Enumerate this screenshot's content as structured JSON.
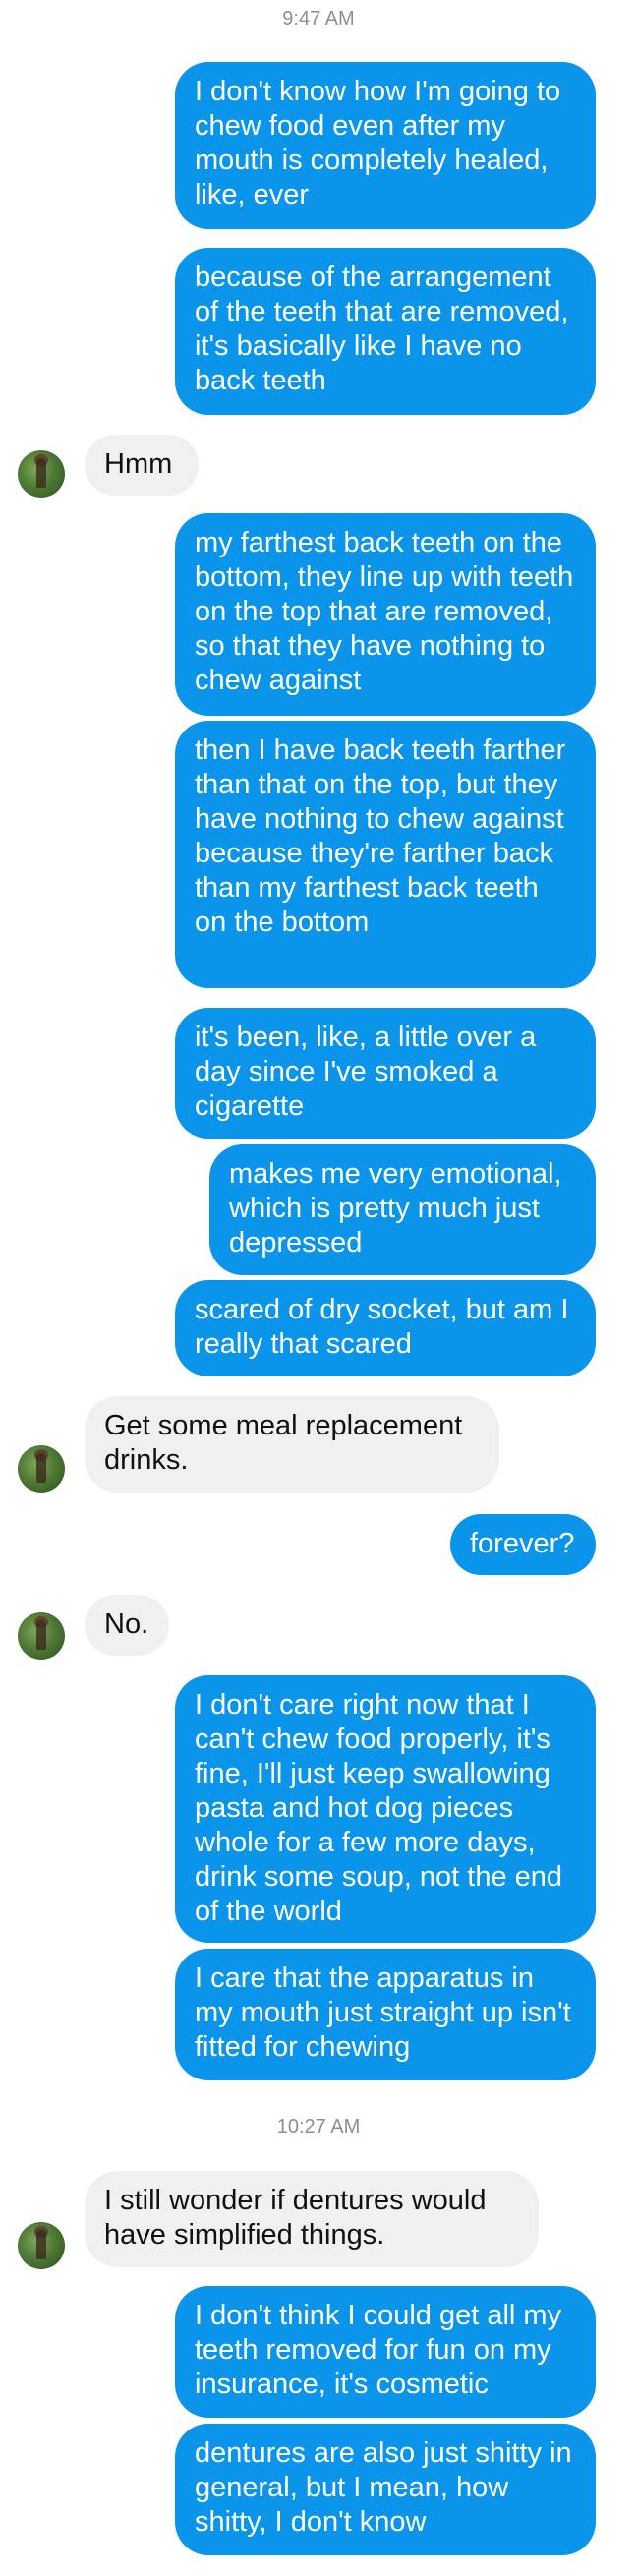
{
  "timestamps": [
    "9:47 AM",
    "10:27 AM"
  ],
  "messages": [
    {
      "dir": "out",
      "text": "I don't know how I'm going to chew food even after my mouth is completely healed, like, ever"
    },
    {
      "dir": "out",
      "text": "because of the arrangement of the teeth that are removed, it's basically like I have no back teeth"
    },
    {
      "dir": "in",
      "text": "Hmm"
    },
    {
      "dir": "out",
      "text": "my farthest back teeth on the bottom, they line up with teeth on the top that are removed, so that they have nothing to chew against"
    },
    {
      "dir": "out",
      "text": "then I have back teeth farther than that on the top, but they have nothing to chew against because they're farther back than my farthest back teeth on the bottom"
    },
    {
      "dir": "out",
      "text": "it's been, like, a little over a day since I've smoked a cigarette"
    },
    {
      "dir": "out",
      "text": "makes me very emotional, which is pretty much just depressed"
    },
    {
      "dir": "out",
      "text": "scared of dry socket, but am I really that scared"
    },
    {
      "dir": "in",
      "text": "Get some meal replacement drinks."
    },
    {
      "dir": "out",
      "text": "forever?"
    },
    {
      "dir": "in",
      "text": "No."
    },
    {
      "dir": "out",
      "text": "I don't care right now that I can't chew food properly, it's fine, I'll just keep swallowing pasta and hot dog pieces whole for a few more days, drink some soup, not the end of the world"
    },
    {
      "dir": "out",
      "text": "I care that the apparatus in my mouth just straight up isn't fitted for chewing"
    },
    {
      "dir": "in",
      "text": "I still wonder if dentures would have simplified things."
    },
    {
      "dir": "out",
      "text": "I don't think I could get all my teeth removed for fun on my insurance, it's cosmetic"
    },
    {
      "dir": "out",
      "text": "dentures are also just shitty in general, but I mean, how shitty, I don't know"
    }
  ]
}
